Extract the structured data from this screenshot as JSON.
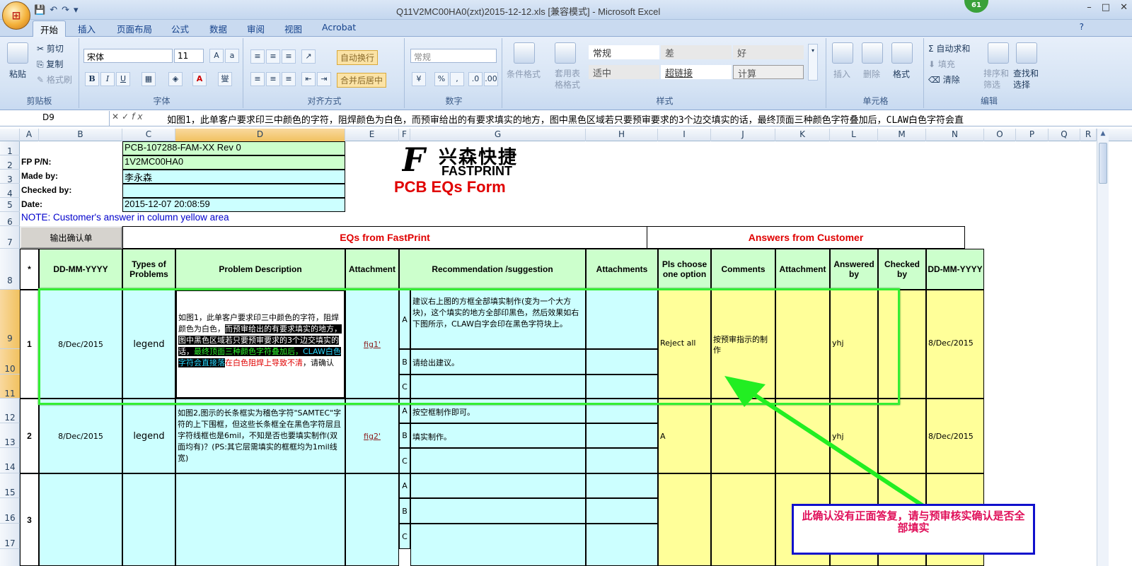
{
  "window": {
    "title": "Q11V2MC00HA0(zxt)2015-12-12.xls  [兼容模式] - Microsoft Excel",
    "notification_count": "61",
    "controls": [
      "–",
      "□",
      "✕"
    ]
  },
  "tabs": [
    "开始",
    "插入",
    "页面布局",
    "公式",
    "数据",
    "审阅",
    "视图",
    "Acrobat"
  ],
  "ribbon": {
    "clipboard": {
      "label": "剪贴板",
      "paste": "粘贴",
      "cut": "剪切",
      "copy": "复制",
      "format_painter": "格式刷"
    },
    "font": {
      "label": "字体",
      "font_name": "宋体",
      "font_size": "11",
      "bold": "B",
      "italic": "I",
      "underline": "U",
      "grow": "A↑",
      "shrink": "A↓",
      "color": "A",
      "phonetic": "燮"
    },
    "alignment": {
      "label": "对齐方式",
      "wrap": "自动换行",
      "merge": "合并后居中"
    },
    "number": {
      "label": "数字",
      "format": "常规",
      "percent": "%"
    },
    "styles": {
      "label": "样式",
      "conditional": "条件格式",
      "table": "套用表格格式",
      "normal": "常规",
      "bad": "差",
      "good": "好",
      "neutral": "适中",
      "hyperlink": "超链接",
      "calculation": "计算"
    },
    "cells": {
      "label": "单元格",
      "insert": "插入",
      "delete": "删除",
      "format": "格式"
    },
    "editing": {
      "label": "编辑",
      "autosum": "自动求和",
      "fill": "填充",
      "clear": "清除",
      "sort": "排序和筛选",
      "find": "查找和选择"
    }
  },
  "formula_bar": {
    "name_box": "D9",
    "fx": "fx",
    "content": "如图1，此单客户要求印三中颜色的字符，阻焊颜色为白色，而预审给出的有要求填实的地方，图中黑色区域若只要预审要求的3个边交填实的话，最终顶面三种颜色字符叠加后，CLAW白色字符会直"
  },
  "columns": [
    "A",
    "B",
    "C",
    "D",
    "E",
    "F",
    "G",
    "H",
    "I",
    "J",
    "K",
    "L",
    "M",
    "N",
    "O",
    "P",
    "Q",
    "R"
  ],
  "rows": [
    "1",
    "2",
    "3",
    "4",
    "5",
    "6",
    "7",
    "8",
    "9",
    "10",
    "11",
    "12",
    "13",
    "14",
    "15",
    "16",
    "17"
  ],
  "header_info": {
    "labels": [
      "FP P/N:",
      "Made by:",
      "Checked by:",
      "Date:"
    ],
    "values": [
      "PCB-107288-FAM-XX Rev 0",
      "1V2MC00HA0",
      "李永森",
      "",
      "2015-12-07 20:08:59"
    ],
    "note": "NOTE: Customer's  answer in column yellow area",
    "export_button": "输出确认单"
  },
  "logo": {
    "cn": "兴森快捷",
    "en": "FASTPRINT",
    "form_title": "PCB EQs Form"
  },
  "table": {
    "section_left": "EQs from FastPrint",
    "section_right": "Answers from Customer",
    "headers": [
      "*",
      "DD-MM-YYYY",
      "Types of Problems",
      "Problem Description",
      "Attachment",
      "Recommendation /suggestion",
      "Attachments",
      "Pls choose one option",
      "Comments",
      "Attachment",
      "Answered by",
      "Checked by",
      "DD-MM-YYYY"
    ],
    "options": [
      "A",
      "B",
      "C"
    ],
    "eq1": {
      "num": "1",
      "date": "8/Dec/2015",
      "type": "legend",
      "desc_a": "如图1，此单客户要求印三中颜色的字符，阻焊颜色为白色，",
      "desc_b": "而预审给出的有要求填实的地方，图中黑色区域若只要预审要求的3个边交填实的话，",
      "desc_c": "最终顶面三种颜色字符叠加后，",
      "desc_d": "CLAW白色字符会直接落",
      "desc_e": "在白色阻焊上导致不清",
      "desc_f": "，请确认",
      "attachment": "fig1'",
      "rec_a": "建议右上图的方框全部填实制作(变为一个大方块)，这个填实的地方全部印黑色，然后效果如右下图所示，CLAW白字会印在黑色字符块上。",
      "rec_b": "请给出建议。",
      "rec_c": "",
      "answer_option": "Reject all",
      "comment": "按预审指示的制作",
      "answered_by": "yhj",
      "answer_date": "8/Dec/2015"
    },
    "eq2": {
      "num": "2",
      "date": "8/Dec/2015",
      "type": "legend",
      "desc": "如图2,图示的长条框实为稽色字符\"SAMTEC\"字符的上下围框，但这些长条框全在黑色字符层且字符线框也是6mil，不知是否也要填实制作(双面均有)？(PS:其它层需填实的框框均为1mil线宽)",
      "attachment": "fig2'",
      "rec_a": "按空框制作即可。",
      "rec_b": "填实制作。",
      "rec_c": "",
      "answer_option": "A",
      "answered_by": "yhj",
      "answer_date": "8/Dec/2015"
    },
    "eq3": {
      "num": "3"
    }
  },
  "annotation": {
    "text": "此确认没有正面答复，请与预审核实确认是否全部填实",
    "arrow_color": "#22ee22",
    "box_color": "#1010cc",
    "text_color": "#e0105a"
  }
}
